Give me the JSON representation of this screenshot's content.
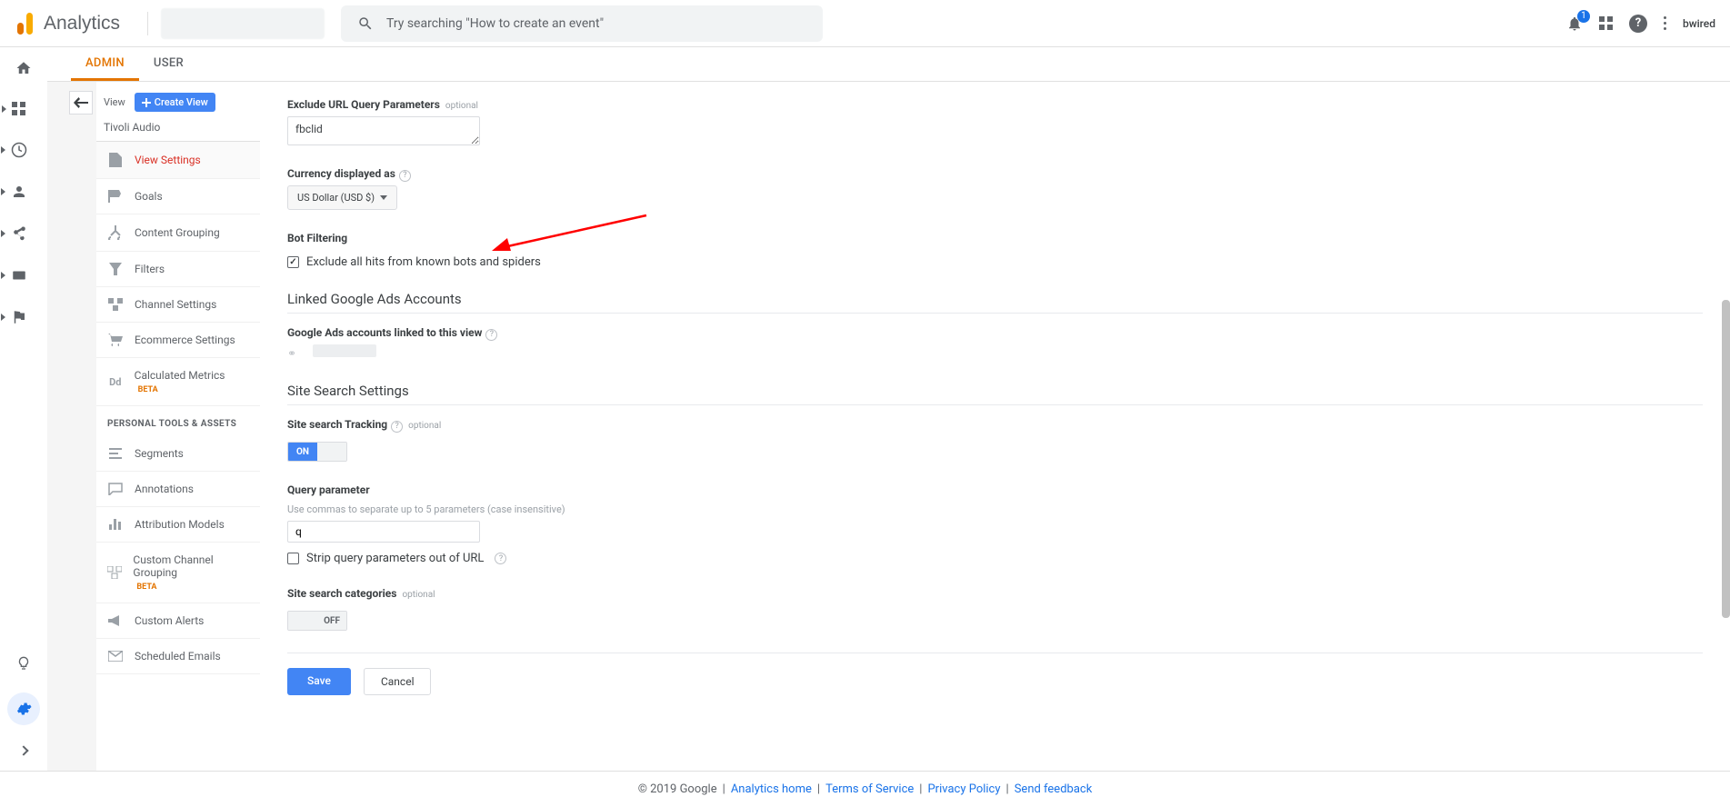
{
  "header": {
    "brand": "Analytics",
    "search_placeholder": "Try searching \"How to create an event\"",
    "notification_count": "1",
    "user_label": "bwired"
  },
  "tabs": {
    "admin": "ADMIN",
    "user": "USER"
  },
  "column": {
    "label": "View",
    "create_btn": "Create View",
    "view_name": "Tivoli Audio",
    "menu": {
      "view_settings": "View Settings",
      "goals": "Goals",
      "content_grouping": "Content Grouping",
      "filters": "Filters",
      "channel_settings": "Channel Settings",
      "ecommerce": "Ecommerce Settings",
      "calc_metrics": "Calculated Metrics",
      "beta": "BETA",
      "personal_heading": "PERSONAL TOOLS & ASSETS",
      "segments": "Segments",
      "annotations": "Annotations",
      "attribution": "Attribution Models",
      "cust_channel": "Custom Channel Grouping",
      "cust_alerts": "Custom Alerts",
      "scheduled": "Scheduled Emails"
    }
  },
  "form": {
    "exclude_url_label": "Exclude URL Query Parameters",
    "optional": "optional",
    "exclude_url_value": "fbclid",
    "currency_label": "Currency displayed as",
    "currency_value": "US Dollar (USD $)",
    "bot_label": "Bot Filtering",
    "bot_checkbox": "Exclude all hits from known bots and spiders",
    "linked_ads_title": "Linked Google Ads Accounts",
    "linked_ads_sub": "Google Ads accounts linked to this view",
    "site_search_title": "Site Search Settings",
    "site_tracking_label": "Site search Tracking",
    "on_label": "ON",
    "off_label": "OFF",
    "query_param_label": "Query parameter",
    "query_param_hint": "Use commas to separate up to 5 parameters (case insensitive)",
    "query_param_value": "q",
    "strip_query": "Strip query parameters out of URL",
    "site_categories_label": "Site search categories",
    "save_btn": "Save",
    "cancel_btn": "Cancel"
  },
  "footer": {
    "copyright": "© 2019 Google",
    "links": {
      "analytics_home": "Analytics home",
      "tos": "Terms of Service",
      "privacy": "Privacy Policy",
      "feedback": "Send feedback"
    }
  }
}
